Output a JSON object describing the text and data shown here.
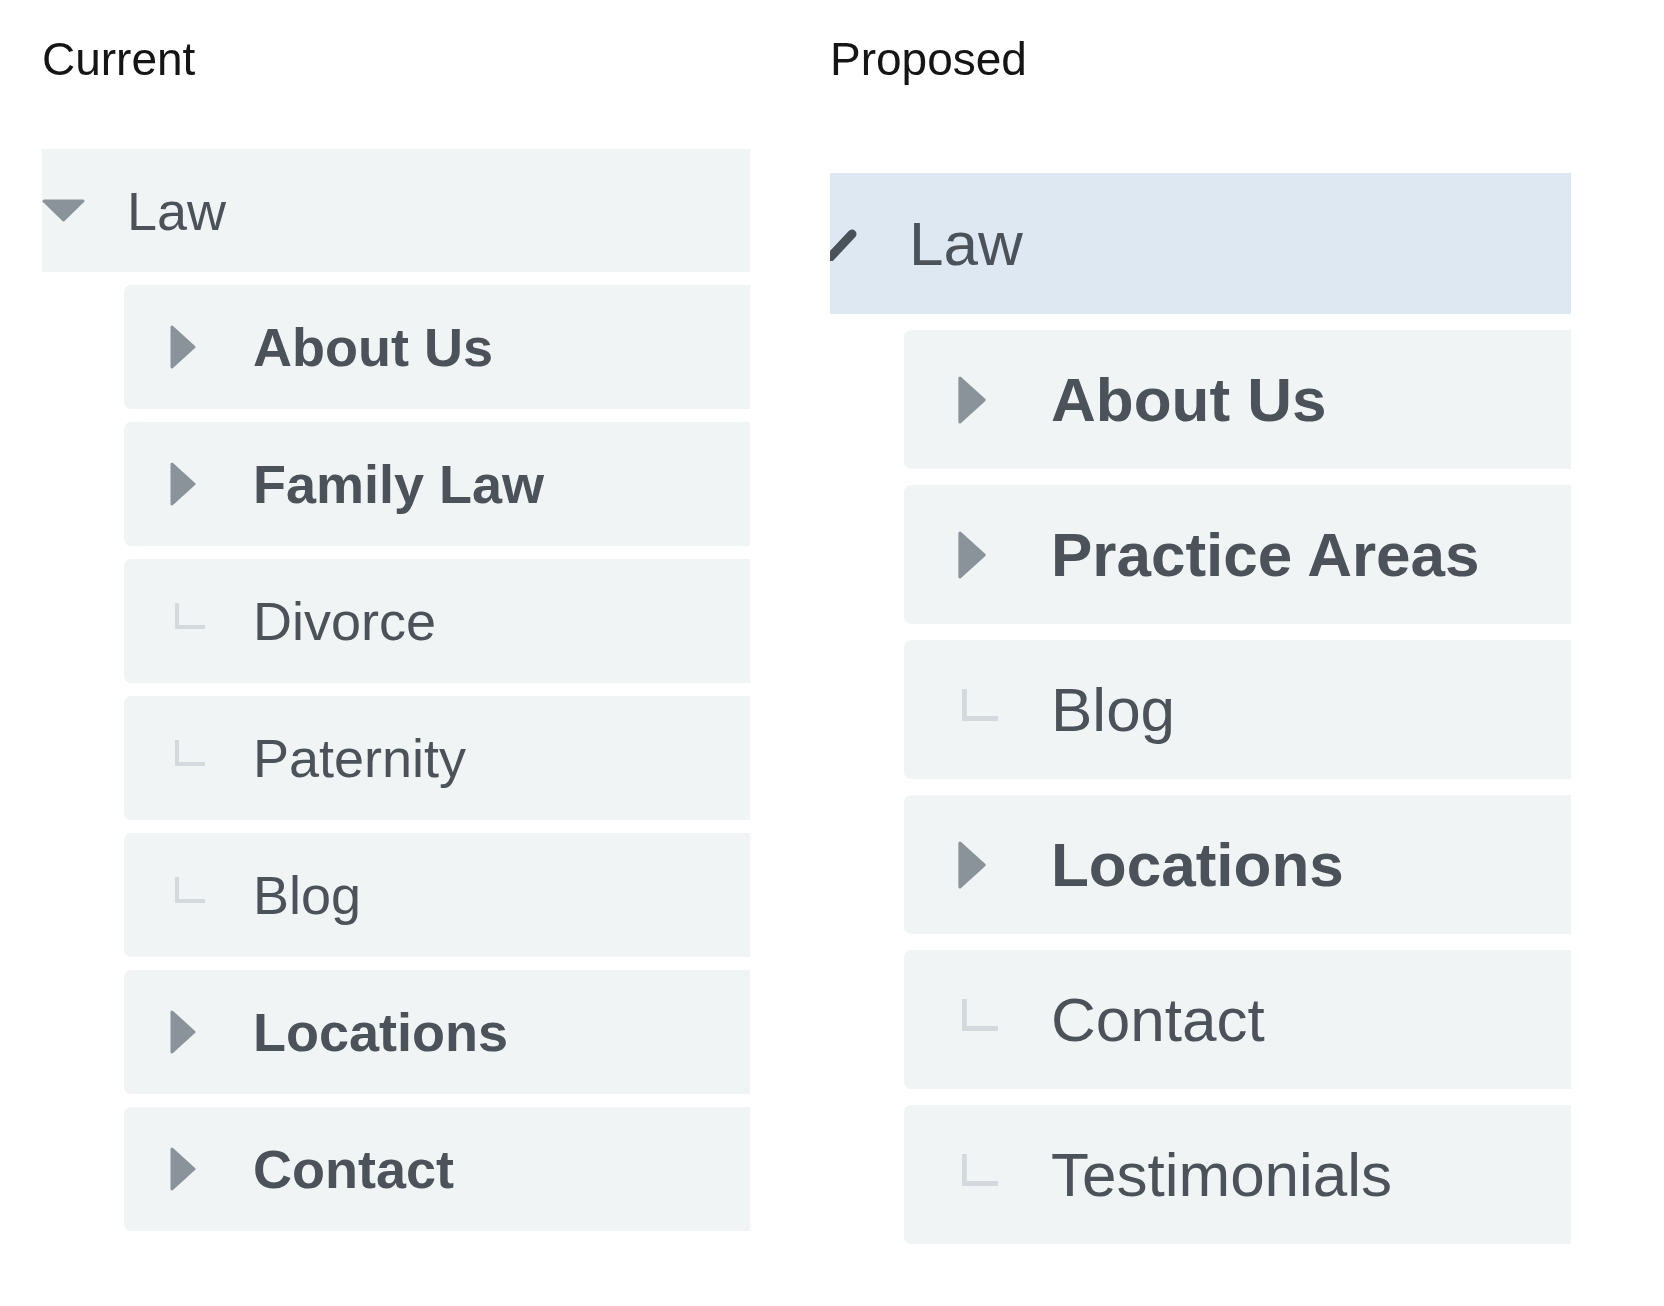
{
  "panels": [
    {
      "title": "Current",
      "tree": [
        {
          "label": "Law",
          "kind": "site",
          "expanded": true,
          "selected": false,
          "children": [
            {
              "label": "About Us",
              "kind": "section",
              "expanded": false,
              "selected": false
            },
            {
              "label": "Family Law",
              "kind": "section",
              "expanded": false,
              "selected": false
            },
            {
              "label": "Divorce",
              "kind": "page",
              "selected": false
            },
            {
              "label": "Paternity",
              "kind": "page",
              "selected": false
            },
            {
              "label": "Blog",
              "kind": "page",
              "selected": false
            },
            {
              "label": "Locations",
              "kind": "section",
              "expanded": false,
              "selected": false
            },
            {
              "label": "Contact",
              "kind": "section",
              "expanded": false,
              "selected": false
            }
          ]
        }
      ]
    },
    {
      "title": "Proposed",
      "tree": [
        {
          "label": "Law",
          "kind": "site",
          "selected": true,
          "children": [
            {
              "label": "About Us",
              "kind": "section",
              "expanded": false,
              "selected": false
            },
            {
              "label": "Practice Areas",
              "kind": "section",
              "expanded": false,
              "selected": false
            },
            {
              "label": "Blog",
              "kind": "page",
              "selected": false
            },
            {
              "label": "Locations",
              "kind": "section",
              "expanded": false,
              "selected": false
            },
            {
              "label": "Contact",
              "kind": "page",
              "selected": false
            },
            {
              "label": "Testimonials",
              "kind": "page",
              "selected": false
            }
          ]
        }
      ]
    }
  ]
}
